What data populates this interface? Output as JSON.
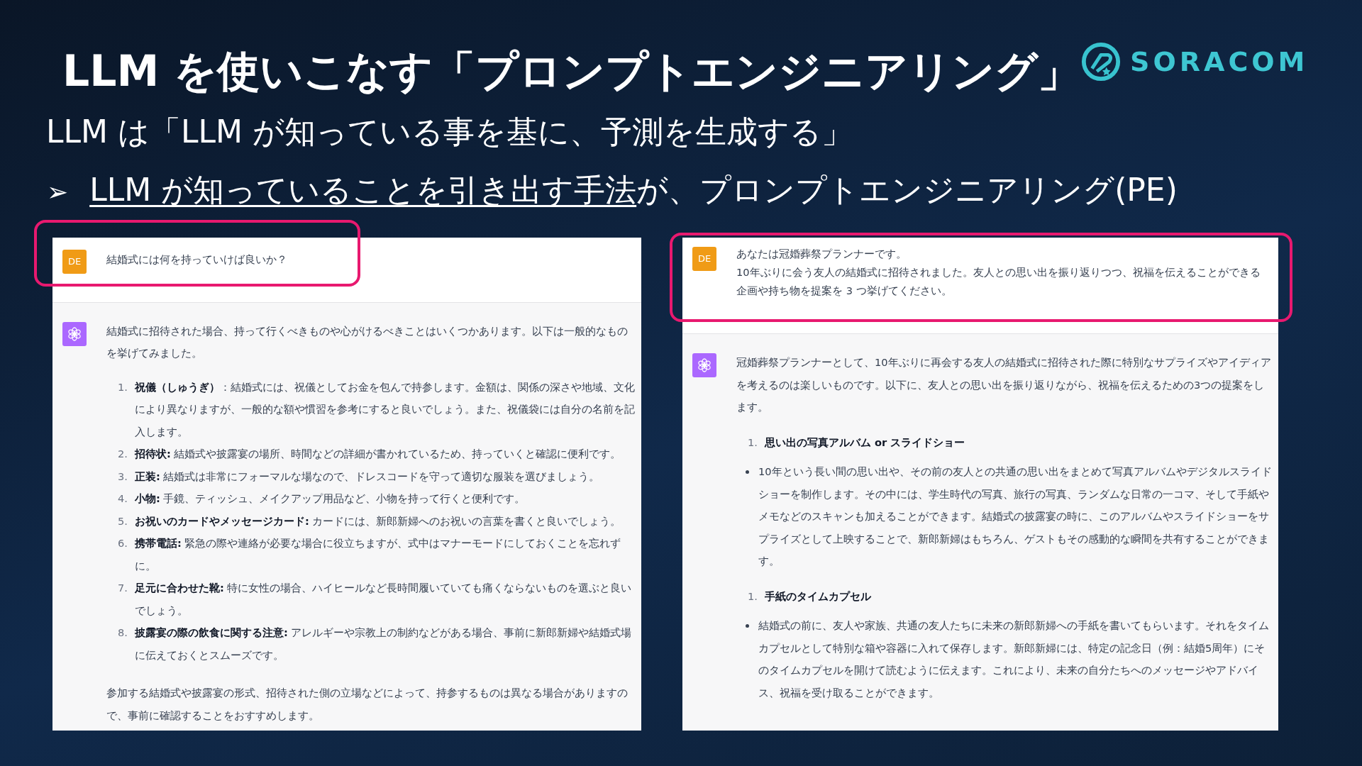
{
  "slide": {
    "title": "LLM を使いこなす「プロンプトエンジニアリング」",
    "logo_text": "SORACOM",
    "statement": "LLM は「LLM が知っている事を基に、予測を生成する」",
    "bullet": {
      "marker": "➢",
      "emphasis": "LLM が知っていることを引き出す手法",
      "rest": "が、プロンプトエンジニアリング(PE)"
    }
  },
  "chats": [
    {
      "kind": "list",
      "highlighted": true,
      "user": {
        "avatar": "DE",
        "lines": [
          "結婚式には何を持っていけば良いか？"
        ]
      },
      "assistant": {
        "intro": "結婚式に招待された場合、持って行くべきものや心がけるべきことはいくつかあります。以下は一般的なものを挙げてみました。",
        "items": [
          {
            "number": "1.",
            "text": "**祝儀（しゅうぎ）**：結婚式には、祝儀としてお金を包んで持参します。金額は、関係の深さや地域、文化により異なりますが、一般的な額や慣習を参考にすると良いでしょう。また、祝儀袋には自分の名前を記入します。"
          },
          {
            "number": "2.",
            "text": "**招待状:** 結婚式や披露宴の場所、時間などの詳細が書かれているため、持っていくと確認に便利です。"
          },
          {
            "number": "3.",
            "text": "**正装:** 結婚式は非常にフォーマルな場なので、ドレスコードを守って適切な服装を選びましょう。"
          },
          {
            "number": "4.",
            "text": "**小物:** 手鏡、ティッシュ、メイクアップ用品など、小物を持って行くと便利です。"
          },
          {
            "number": "5.",
            "text": "**お祝いのカードやメッセージカード:** カードには、新郎新婦へのお祝いの言葉を書くと良いでしょう。"
          },
          {
            "number": "6.",
            "text": "**携帯電話:** 緊急の際や連絡が必要な場合に役立ちますが、式中はマナーモードにしておくことを忘れずに。"
          },
          {
            "number": "7.",
            "text": "**足元に合わせた靴:** 特に女性の場合、ハイヒールなど長時間履いていても痛くならないものを選ぶと良いでしょう。"
          },
          {
            "number": "8.",
            "text": "**披露宴の際の飲食に関する注意:** アレルギーや宗教上の制約などがある場合、事前に新郎新婦や結婚式場に伝えておくとスムーズです。"
          }
        ],
        "outro": "参加する結婚式や披露宴の形式、招待された側の立場などによって、持参するものは異なる場合がありますので、事前に確認することをおすすめします。"
      }
    },
    {
      "kind": "sections",
      "highlighted": true,
      "user": {
        "avatar": "DE",
        "lines": [
          "あなたは冠婚葬祭プランナーです。",
          "10年ぶりに会う友人の結婚式に招待されました。友人との思い出を振り返りつつ、祝福を伝えることができる企画や持ち物を提案を 3 つ挙げてください。"
        ]
      },
      "assistant": {
        "intro": "冠婚葬祭プランナーとして、10年ぶりに再会する友人の結婚式に招待された際に特別なサプライズやアイディアを考えるのは楽しいものです。以下に、友人との思い出を振り返りながら、祝福を伝えるための3つの提案をします。",
        "sections": [
          {
            "number": "1.",
            "title": "思い出の写真アルバム or スライドショー",
            "bullets": [
              "10年という長い間の思い出や、その前の友人との共通の思い出をまとめて写真アルバムやデジタルスライドショーを制作します。その中には、学生時代の写真、旅行の写真、ランダムな日常の一コマ、そして手紙やメモなどのスキャンも加えることができます。結婚式の披露宴の時に、このアルバムやスライドショーをサプライズとして上映することで、新郎新婦はもちろん、ゲストもその感動的な瞬間を共有することができます。"
            ]
          },
          {
            "number": "1.",
            "title": "手紙のタイムカプセル",
            "bullets": [
              "結婚式の前に、友人や家族、共通の友人たちに未来の新郎新婦への手紙を書いてもらいます。それをタイムカプセルとして特別な箱や容器に入れて保存します。新郎新婦には、特定の記念日（例：結婚5周年）にそのタイムカプセルを開けて読むように伝えます。これにより、未来の自分たちへのメッセージやアドバイス、祝福を受け取ることができます。"
            ]
          }
        ]
      }
    }
  ]
}
